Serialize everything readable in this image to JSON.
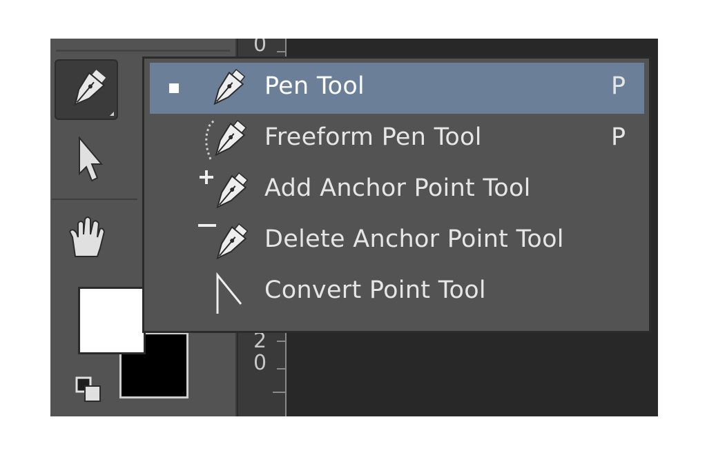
{
  "toolbar": {
    "tools": [
      {
        "name": "pen",
        "icon": "pen-icon",
        "active": true
      },
      {
        "name": "path-selection",
        "icon": "arrow-icon",
        "active": false
      },
      {
        "name": "hand",
        "icon": "hand-icon",
        "active": false
      }
    ],
    "foreground_color": "#ffffff",
    "background_color": "#000000"
  },
  "ruler": {
    "top_number": "0",
    "mid_digit_a": "2",
    "mid_digit_b": "0"
  },
  "flyout": {
    "items": [
      {
        "label": "Pen Tool",
        "shortcut": "P",
        "icon": "pen-icon",
        "selected": true
      },
      {
        "label": "Freeform Pen Tool",
        "shortcut": "P",
        "icon": "freeform-pen-icon",
        "selected": false
      },
      {
        "label": "Add Anchor Point Tool",
        "shortcut": "",
        "icon": "add-anchor-point-icon",
        "selected": false
      },
      {
        "label": "Delete Anchor Point Tool",
        "shortcut": "",
        "icon": "delete-anchor-point-icon",
        "selected": false
      },
      {
        "label": "Convert Point Tool",
        "shortcut": "",
        "icon": "convert-point-icon",
        "selected": false
      }
    ],
    "selected_highlight_color": "#6b7f99"
  }
}
